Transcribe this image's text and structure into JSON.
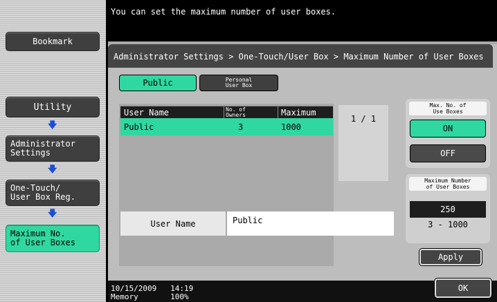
{
  "message": "You can set the maximum number of user boxes.",
  "breadcrumb": "Administrator Settings > One-Touch/User Box > Maximum Number of User Boxes",
  "sidebar": {
    "bookmark": "Bookmark",
    "items": [
      {
        "label": "Utility"
      },
      {
        "label": "Administrator\nSettings"
      },
      {
        "label": "One-Touch/\nUser Box Reg."
      },
      {
        "label": "Maximum No.\nof User Boxes"
      }
    ],
    "arrow": "🡇"
  },
  "tabs": {
    "public": "Public",
    "personal": "Personal\nUser Box"
  },
  "table": {
    "headers": [
      "User Name",
      "No. of\nOwners",
      "Maximum"
    ],
    "rows": [
      {
        "user_name": "Public",
        "owners": "3",
        "maximum": "1000"
      }
    ]
  },
  "pager": "1 /  1",
  "user_name_field": {
    "label": "User Name",
    "value": "Public"
  },
  "max_boxes": {
    "title": "Max. No. of\nUse Boxes",
    "on": "ON",
    "off": "OFF"
  },
  "max_number": {
    "title": "Maximum Number\nof User Boxes",
    "value": "250",
    "range": "3 - 1000",
    "apply": "Apply"
  },
  "footer": {
    "datetime": "10/15/2009   14:19",
    "memory": "Memory       100%",
    "ok": "OK"
  },
  "colors": {
    "accent": "#2fd8a0",
    "dark": "#444444"
  }
}
